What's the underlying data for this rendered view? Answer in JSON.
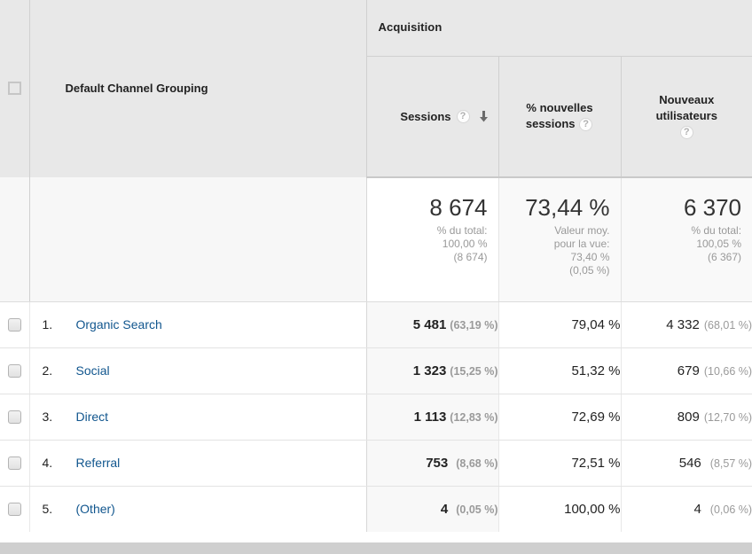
{
  "table": {
    "group_header": "Acquisition",
    "dimension_header": "Default Channel Grouping",
    "columns": [
      {
        "key": "sessions",
        "label": "Sessions",
        "help": "?",
        "sorted": true,
        "sort_dir": "desc",
        "align": "right"
      },
      {
        "key": "new_sessions",
        "label_line1": "% nouvelles",
        "label_line2": "sessions",
        "help": "?",
        "sorted": false,
        "align": "center"
      },
      {
        "key": "new_users",
        "label_line1": "Nouveaux",
        "label_line2": "utilisateurs",
        "help": "?",
        "sorted": false,
        "align": "center"
      }
    ],
    "summary": {
      "sessions": {
        "value": "8 674",
        "sub_line1": "% du total:",
        "sub_line2": "100,00 %",
        "sub_line3": "(8 674)"
      },
      "new_sessions": {
        "value": "73,44 %",
        "sub_line1": "Valeur moy.",
        "sub_line2": "pour la vue:",
        "sub_line3": "73,40 %",
        "sub_line4": "(0,05 %)"
      },
      "new_users": {
        "value": "6 370",
        "sub_line1": "% du total:",
        "sub_line2": "100,05 %",
        "sub_line3": "(6 367)"
      }
    },
    "rows": [
      {
        "index": "1.",
        "dimension": "Organic Search",
        "sessions": "5 481",
        "sessions_pct": "(63,19 %)",
        "new_sessions": "79,04 %",
        "new_users": "4 332",
        "new_users_pct": "(68,01 %)"
      },
      {
        "index": "2.",
        "dimension": "Social",
        "sessions": "1 323",
        "sessions_pct": "(15,25 %)",
        "new_sessions": "51,32 %",
        "new_users": "679",
        "new_users_pct": "(10,66 %)"
      },
      {
        "index": "3.",
        "dimension": "Direct",
        "sessions": "1 113",
        "sessions_pct": "(12,83 %)",
        "new_sessions": "72,69 %",
        "new_users": "809",
        "new_users_pct": "(12,70 %)"
      },
      {
        "index": "4.",
        "dimension": "Referral",
        "sessions": "753",
        "sessions_pct": "(8,68 %)",
        "new_sessions": "72,51 %",
        "new_users": "546",
        "new_users_pct": "(8,57 %)"
      },
      {
        "index": "5.",
        "dimension": "(Other)",
        "sessions": "4",
        "sessions_pct": "(0,05 %)",
        "new_sessions": "100,00 %",
        "new_users": "4",
        "new_users_pct": "(0,06 %)"
      }
    ]
  },
  "icons": {
    "help": "help-icon",
    "sort_desc": "sort-descending-arrow-icon",
    "checkbox": "checkbox-icon"
  },
  "colors": {
    "link": "#11568e",
    "header_bg": "#e8e8e8",
    "sorted_col_bg": "#f8f8f8",
    "muted_text": "#9a9a9a"
  }
}
